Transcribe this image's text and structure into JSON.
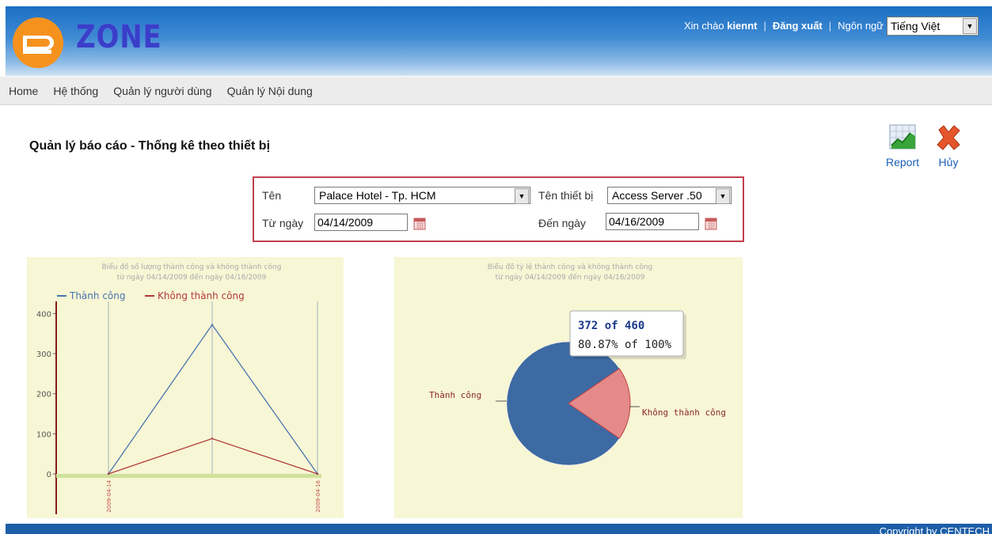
{
  "header": {
    "logo_text": "ZONE",
    "greeting": "Xin chào",
    "username": "kiennt",
    "logout": "Đăng xuất",
    "language_label": "Ngôn ngữ",
    "language_value": "Tiếng Việt"
  },
  "nav": {
    "items": [
      "Home",
      "Hệ thống",
      "Quản lý người dùng",
      "Quản lý Nội dung"
    ]
  },
  "page": {
    "title": "Quản lý báo cáo - Thống kê theo thiết bị"
  },
  "toolbar": {
    "report_label": "Report",
    "cancel_label": "Hủy"
  },
  "filter": {
    "name_label": "Tên",
    "name_value": "Palace Hotel - Tp. HCM",
    "device_label": "Tên thiết bị",
    "device_value": "Access Server .50",
    "from_label": "Từ ngày",
    "from_value": "04/14/2009",
    "to_label": "Đến ngày",
    "to_value": "04/16/2009"
  },
  "chart_data": [
    {
      "type": "line",
      "title": "Biểu đồ số lượng thành công và không thành công",
      "subtitle": "từ ngày 04/14/2009 đến ngày 04/16/2009",
      "x": [
        "2009-04-14",
        "",
        "2009-04-16"
      ],
      "series": [
        {
          "name": "Thành công",
          "values": [
            0,
            372,
            0
          ],
          "color": "#4a74b0"
        },
        {
          "name": "Không thành công",
          "values": [
            0,
            88,
            0
          ],
          "color": "#b23a3a"
        }
      ],
      "yticks": [
        0,
        100,
        200,
        300,
        400
      ],
      "ylim": [
        0,
        450
      ],
      "legend": "top-left",
      "grid": false
    },
    {
      "type": "pie",
      "title": "Biểu đồ tỷ lệ thành công và không thành công",
      "subtitle": "từ ngày 04/14/2009 đến ngày 04/16/2009",
      "slices": [
        {
          "label": "Thành công",
          "value": 372,
          "color": "#3e6aa3"
        },
        {
          "label": "Không thành công",
          "value": 88,
          "color": "#e58a8a"
        }
      ],
      "tooltip": {
        "line1": "372 of 460",
        "line2": "80.87% of 100%"
      }
    }
  ],
  "footer": {
    "text": "Copyright by CENTECH"
  }
}
